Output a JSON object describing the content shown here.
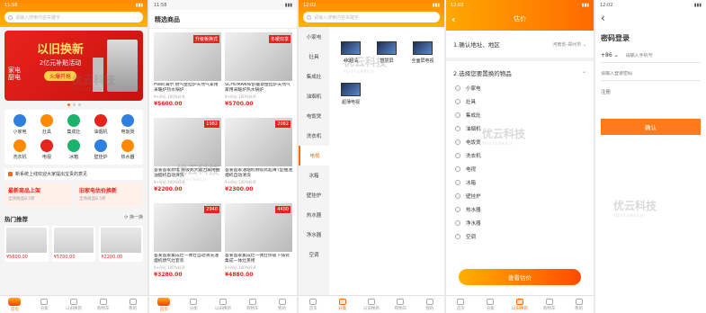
{
  "status": {
    "time1": "11:58",
    "time2": "11:58",
    "time3": "12:02",
    "time4": "12:02",
    "time5": "12:02"
  },
  "home": {
    "search_placeholder": "请输入搜索内容关键字",
    "banner": {
      "line1": "以旧换新",
      "line2": "2亿元补贴活动",
      "btn": "火爆开抢",
      "side1": "家电",
      "side2": "厨电"
    },
    "cats": [
      {
        "label": "小家电"
      },
      {
        "label": "灶具"
      },
      {
        "label": "集成灶"
      },
      {
        "label": "油烟机"
      },
      {
        "label": "电饭煲"
      },
      {
        "label": "洗衣机"
      },
      {
        "label": "电视"
      },
      {
        "label": "冰箱"
      },
      {
        "label": "壁挂炉"
      },
      {
        "label": "热水器"
      }
    ],
    "notice": "新系统上线欢迎大家提出宝贵的意见",
    "promo": [
      {
        "title": "最新商品上架",
        "sub": "全场商品8.5折"
      },
      {
        "title": "旧家电估价换新",
        "sub": "全场商品8.5折"
      }
    ],
    "hot": {
      "title": "热门推荐",
      "refresh": "换一换",
      "prices": [
        "¥5600.00",
        "¥5700.00",
        "¥2200.00"
      ]
    }
  },
  "picks": {
    "title": "精选商品",
    "items": [
      {
        "name": "Hiee/海尔 燃气壁挂炉天然气家用采暖炉热水锅炉",
        "sales": "9+评论 100%好评",
        "price": "¥5600.00",
        "tag": "升级板换式"
      },
      {
        "name": "SCHUMANN/舒曼斯壁挂炉天然气家用采暖炉热水锅炉",
        "sales": "9+评论 100%好评",
        "price": "¥5700.00",
        "tag": "冬暖双享"
      },
      {
        "name": "吾爱吾家厨电 侧吸式大吸力家用抽油烟机自动清洗",
        "sales": "9+评论 100%好评",
        "price": "¥2200.00",
        "tag": "1982"
      },
      {
        "name": "吾爱吾家油烟机侧吸式超薄T型抽油烟机自动清洗",
        "sales": "9+评论 100%好评",
        "price": "¥2300.00",
        "tag": "2082"
      },
      {
        "name": "吾爱吾家集成灶一体灶自动清洗油烟机燃气灶套装",
        "sales": "9+评论 100%好评",
        "price": "¥3280.00",
        "tag": "2940"
      },
      {
        "name": "吾爱吾家集成灶一体灶侧吸下排式集成一体灶蒸烤",
        "sales": "9+评论 100%好评",
        "price": "¥4880.00",
        "tag": "4400"
      }
    ]
  },
  "category": {
    "search_placeholder": "请输入搜索内容关键字",
    "side": [
      "小家电",
      "灶具",
      "集成灶",
      "油烟机",
      "电饭煲",
      "洗衣机",
      "电视",
      "冰箱",
      "壁挂炉",
      "热水器",
      "净水器",
      "空调"
    ],
    "active": "电视",
    "items": [
      {
        "label": "4K超清"
      },
      {
        "label": "智慧屏"
      },
      {
        "label": "全面屏电视"
      },
      {
        "label": "超薄电视"
      }
    ]
  },
  "estimate": {
    "title": "估价",
    "step1": "1.确认地址、地区",
    "region": "河南省-郑州市",
    "step2": "2.选择您要置换的物品",
    "options": [
      "小家电",
      "灶具",
      "集成灶",
      "油烟机",
      "电饭煲",
      "洗衣机",
      "电视",
      "冰箱",
      "壁挂炉",
      "热水器",
      "净水器",
      "空调"
    ],
    "button": "查看估价"
  },
  "login": {
    "title": "密码登录",
    "code": "+86",
    "phone_placeholder": "请输入手机号",
    "pwd_placeholder": "请输入登录密码",
    "register": "注册",
    "button": "确认"
  },
  "tabs": [
    "首页",
    "分类",
    "以旧换新",
    "购物车",
    "我的"
  ],
  "watermark": {
    "text": "优云科技",
    "sub": "YOUYUNKEJI"
  },
  "colors": {
    "accent": "#ff6a00",
    "red": "#e8231d",
    "yellow": "#ffd24a"
  }
}
